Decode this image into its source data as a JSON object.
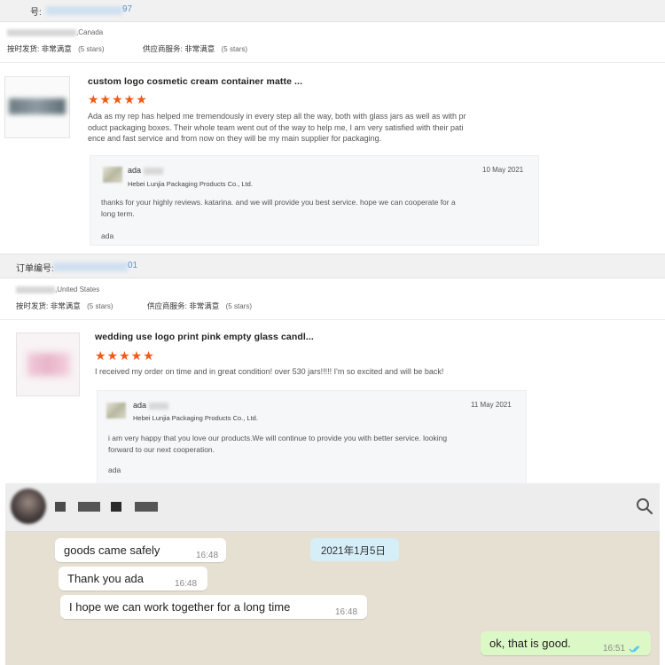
{
  "order1": {
    "order_label": "号:",
    "order_suffix": "97",
    "buyer_country": ",Canada",
    "ratings": [
      {
        "label": "按时发货:",
        "value": "非常满意",
        "stars": "(5 stars)"
      },
      {
        "label": "供应商服务:",
        "value": "非常满意",
        "stars": "(5 stars)"
      }
    ],
    "product_title": "custom logo cosmetic cream container matte ...",
    "star_rating": "★★★★★",
    "review_lines": [
      "Ada as my rep has helped me tremendously in every step all the way, both with glass jars as well as with pr",
      "oduct packaging boxes. Their whole team went out of the way to help me, I am very satisfied with their pati",
      "ence and fast service and from now on they will be my main supplier for packaging."
    ],
    "reply": {
      "name": "ada",
      "company": "Hebei Lunjia Packaging Products Co., Ltd.",
      "date": "10 May 2021",
      "lines": [
        "thanks for your highly reviews. katarina.  and we will provide you best service. hope we can cooperate for a",
        "long term."
      ],
      "signature": "ada"
    }
  },
  "order2": {
    "order_label": "订单编号:",
    "order_suffix": "01",
    "buyer_country": ",United States",
    "ratings": [
      {
        "label": "按时发货:",
        "value": "非常满意",
        "stars": "(5 stars)"
      },
      {
        "label": "供应商服务:",
        "value": "非常满意",
        "stars": "(5 stars)"
      }
    ],
    "product_title": "wedding use logo print pink empty glass candl...",
    "star_rating": "★★★★★",
    "review_lines": [
      "I received my order on time and in great condition! over 530 jars!!!!! I'm so excited and will be back!"
    ],
    "reply": {
      "name": "ada",
      "company": "Hebei Lunjia Packaging Products Co., Ltd.",
      "date": "11 May 2021",
      "lines": [
        "i am very happy that you love our products.We will continue to provide you with better service. looking",
        "forward to our next cooperation."
      ],
      "signature": "ada"
    }
  },
  "chat": {
    "date_divider": "2021年1月5日",
    "messages": [
      {
        "text": "goods came safely",
        "time": "16:48",
        "direction": "in"
      },
      {
        "text": "Thank you ada",
        "time": "16:48",
        "direction": "in"
      },
      {
        "text": "I hope we can work together for a long time",
        "time": "16:48",
        "direction": "in"
      },
      {
        "text": "ok, that is good.",
        "time": "16:51",
        "direction": "out"
      }
    ],
    "search_icon": "search-icon",
    "read_icon": "double-check-icon"
  },
  "colors": {
    "star": "#f05a14",
    "outgoing_bubble": "#dcf8c6",
    "chat_bg": "#e6e0d3",
    "read_tick": "#4fc3f7"
  }
}
